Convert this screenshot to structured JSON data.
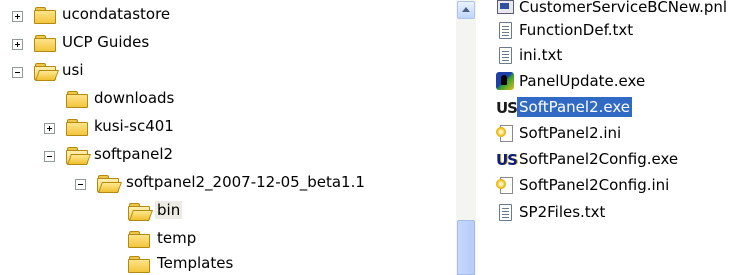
{
  "tree": {
    "nodes": [
      {
        "label": "ucondatastore",
        "expander": "plus",
        "open": false,
        "selected": false
      },
      {
        "label": "UCP Guides",
        "expander": "plus",
        "open": false,
        "selected": false
      },
      {
        "label": "usi",
        "expander": "minus",
        "open": true,
        "selected": false
      },
      {
        "label": "downloads",
        "expander": "none",
        "open": false,
        "selected": false
      },
      {
        "label": "kusi-sc401",
        "expander": "plus",
        "open": false,
        "selected": false
      },
      {
        "label": "softpanel2",
        "expander": "minus",
        "open": true,
        "selected": false
      },
      {
        "label": "softpanel2_2007-12-05_beta1.1",
        "expander": "minus",
        "open": true,
        "selected": false
      },
      {
        "label": "bin",
        "expander": "none",
        "open": true,
        "selected": true
      },
      {
        "label": "temp",
        "expander": "none",
        "open": false,
        "selected": false
      },
      {
        "label": "Templates",
        "expander": "none",
        "open": false,
        "selected": false
      }
    ]
  },
  "files": {
    "items": [
      {
        "label": "CustomerServiceBCNew.pnl",
        "icon": "panel-file-icon",
        "selected": false
      },
      {
        "label": "FunctionDef.txt",
        "icon": "text-file-icon",
        "selected": false
      },
      {
        "label": "ini.txt",
        "icon": "text-file-icon",
        "selected": false
      },
      {
        "label": "PanelUpdate.exe",
        "icon": "panelupdate-app-icon",
        "selected": false
      },
      {
        "label": "SoftPanel2.exe",
        "icon": "us-app-icon",
        "selected": true
      },
      {
        "label": "SoftPanel2.ini",
        "icon": "ini-file-icon",
        "selected": false
      },
      {
        "label": "SoftPanel2Config.exe",
        "icon": "us-app-icon",
        "selected": false
      },
      {
        "label": "SoftPanel2Config.ini",
        "icon": "ini-file-icon",
        "selected": false
      },
      {
        "label": "SP2Files.txt",
        "icon": "text-file-icon",
        "selected": false
      }
    ]
  },
  "icons": {
    "us_glyph": "US"
  },
  "colors": {
    "selection": "#316ac5",
    "folder": "#f2c53c",
    "tree_selection": "#ecece4"
  }
}
